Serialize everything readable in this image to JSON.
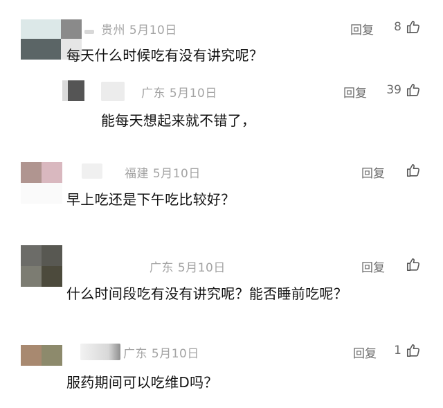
{
  "comments": [
    {
      "location": "贵州",
      "date": "5月10日",
      "reply": "回复",
      "likes": "8",
      "text": "每天什么时候吃有没有讲究呢？"
    },
    {
      "location": "广东",
      "date": "5月10日",
      "reply": "回复",
      "likes": "39",
      "text": "能每天想起来就不错了，"
    },
    {
      "location": "福建",
      "date": "5月10日",
      "reply": "回复",
      "likes": "",
      "text": "早上吃还是下午吃比较好？"
    },
    {
      "location": "广东",
      "date": "5月10日",
      "reply": "回复",
      "likes": "",
      "text": "什么时间段吃有没有讲究呢？能否睡前吃呢？"
    },
    {
      "location": "广东",
      "date": "5月10日",
      "reply": "回复",
      "likes": "1",
      "text": "服药期间可以吃维D吗？"
    }
  ],
  "icons": {
    "like": "thumbs-up-icon"
  },
  "colors": {
    "meta": "#a3a3a3",
    "action": "#6b6b6b",
    "text": "#111111"
  }
}
